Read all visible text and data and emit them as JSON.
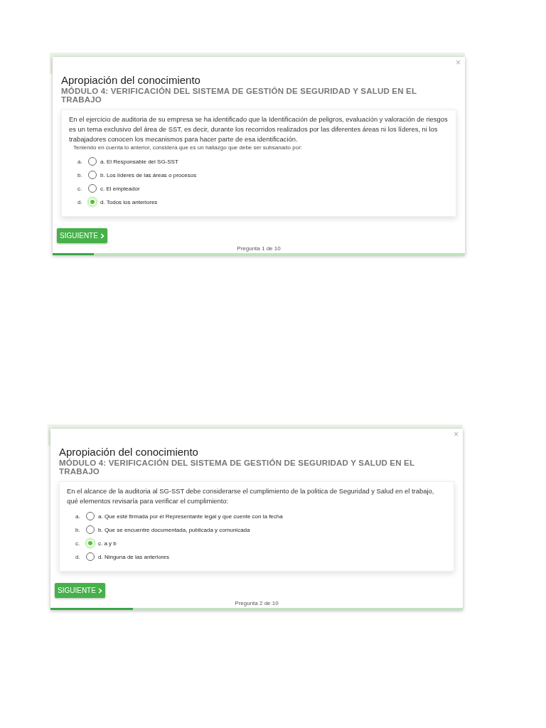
{
  "screenshots": [
    {
      "title": "Apropiación del conocimiento",
      "subtitle": "MÓDULO 4: VERIFICACIÓN DEL SISTEMA DE GESTIÓN DE SEGURIDAD Y SALUD EN EL TRABAJO",
      "close": "×",
      "question": "En el ejercicio de auditoria de su empresa se ha identificado que la Identificación de peligros, evaluación y valoración de riesgos es un tema exclusivo del área de SST, es decir, durante los recorridos realizados por las diferentes áreas ni los líderes, ni los trabajadores conocen los mecanismos para hacer parte de esa identificación.",
      "note": "Teniendo en cuenta lo anterior, considera que es un hallazgo que debe ser subsanado por:",
      "options": [
        {
          "letter": "a.",
          "label": "a. El Responsable del SG-SST",
          "selected": false
        },
        {
          "letter": "b.",
          "label": "b. Los líderes de las áreas o procesos",
          "selected": false
        },
        {
          "letter": "c.",
          "label": "c. El empleador",
          "selected": false
        },
        {
          "letter": "d.",
          "label": "d. Todos los anteriores",
          "selected": true
        }
      ],
      "button": "SIGUIENTE",
      "counter": "Pregunta 1 de 10",
      "progress": {
        "level": 0.1
      }
    },
    {
      "title": "Apropiación del conocimiento",
      "subtitle": "MÓDULO 4: VERIFICACIÓN DEL SISTEMA DE GESTIÓN DE SEGURIDAD Y SALUD EN EL TRABAJO",
      "close": "×",
      "question": "En el alcance de la auditoria al SG-SST debe considerarse el cumplimiento de la politica de Seguridad y Salud en el trabajo, qué elementos revisaría para verificar el cumplimiento:",
      "options": [
        {
          "letter": "a.",
          "label": "a. Que esté firmada por el Representante legal y que cuente con la fecha",
          "selected": false
        },
        {
          "letter": "b.",
          "label": "b. Que se encuentre documentada, publicada y comunicada",
          "selected": false
        },
        {
          "letter": "c.",
          "label": "c. a y b",
          "selected": true
        },
        {
          "letter": "d.",
          "label": "d. Ninguna de las anteriores",
          "selected": false
        }
      ],
      "button": "SIGUIENTE",
      "counter": "Pregunta 2 de 10",
      "progress": {
        "level": 0.2
      }
    }
  ]
}
